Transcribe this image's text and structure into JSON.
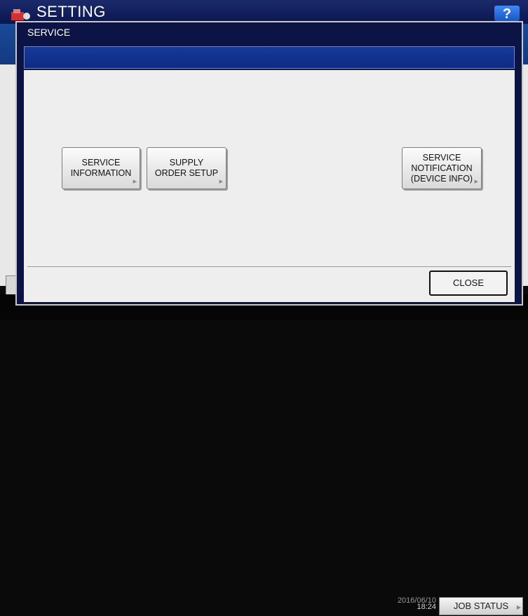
{
  "background": {
    "app_title": "SETTING",
    "help_label": "?",
    "clock_date": "2016/06/10",
    "clock_time": "18:24",
    "job_status_label": "JOB STATUS"
  },
  "dialog": {
    "title": "SERVICE",
    "buttons": [
      {
        "label": "SERVICE\nINFORMATION"
      },
      {
        "label": "SUPPLY\nORDER SETUP"
      },
      {
        "label": "SERVICE\nNOTIFICATION\n(DEVICE INFO)"
      }
    ],
    "close_label": "CLOSE"
  },
  "colors": {
    "title_bar": "#0b1650",
    "header_band": "#15399a",
    "dialog_body": "#eeeeee"
  }
}
